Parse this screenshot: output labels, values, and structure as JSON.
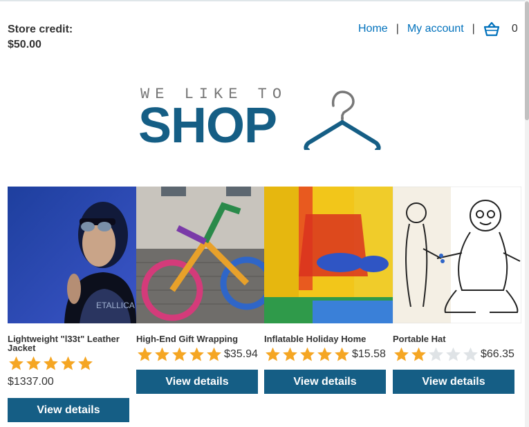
{
  "header": {
    "store_credit_label": "Store credit:",
    "store_credit_value": "$50.00",
    "nav": {
      "home": "Home",
      "separator": "|",
      "my_account": "My account",
      "cart_icon": "basket-icon",
      "cart_count": "0"
    }
  },
  "logo": {
    "tagline": "WE LIKE TO",
    "word": "SHOP",
    "icon": "hanger-icon",
    "color": "#155e85"
  },
  "colors": {
    "accent": "#155e85",
    "link": "#0071bc",
    "star_filled": "#f5a623",
    "star_empty": "#dfe3e6"
  },
  "products": [
    {
      "title": "Lightweight \"l33t\" Leather Jacket",
      "rating": 5,
      "price": "$1337.00",
      "button": "View details",
      "image": "person-with-headphones-photo"
    },
    {
      "title": "High-End Gift Wrapping",
      "rating": 5,
      "price": "$35.94",
      "button": "View details",
      "image": "yarn-bombed-bicycle-photo"
    },
    {
      "title": "Inflatable Holiday Home",
      "rating": 5,
      "price": "$15.58",
      "button": "View details",
      "image": "bouncy-castle-photo"
    },
    {
      "title": "Portable Hat",
      "rating": 2,
      "price": "$66.35",
      "button": "View details",
      "image": "sketch-drawing"
    }
  ]
}
